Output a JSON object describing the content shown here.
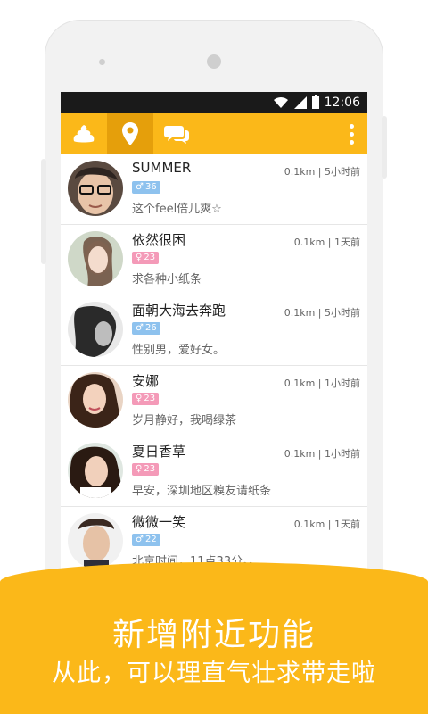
{
  "status_bar": {
    "time": "12:06"
  },
  "toolbar": {
    "tabs": [
      {
        "icon": "poop-icon"
      },
      {
        "icon": "location-pin-icon"
      },
      {
        "icon": "chat-bubbles-icon"
      }
    ],
    "menu_icon": "overflow-menu-icon"
  },
  "colors": {
    "accent": "#fbb819",
    "accent_dark": "#e59f0b",
    "male": "#8ec2ee",
    "female": "#f49ab8"
  },
  "users": [
    {
      "name": "SUMMER",
      "gender": "♂",
      "age": "36",
      "distance_time": "0.1km | 5小时前",
      "signature": "这个feel倍儿爽☆"
    },
    {
      "name": "依然很困",
      "gender": "♀",
      "age": "23",
      "distance_time": "0.1km | 1天前",
      "signature": "求各种小纸条"
    },
    {
      "name": "面朝大海去奔跑",
      "gender": "♂",
      "age": "26",
      "distance_time": "0.1km | 5小时前",
      "signature": "性别男，爱好女。"
    },
    {
      "name": "安娜",
      "gender": "♀",
      "age": "23",
      "distance_time": "0.1km | 1小时前",
      "signature": "岁月静好，我喝绿茶"
    },
    {
      "name": "夏日香草",
      "gender": "♀",
      "age": "23",
      "distance_time": "0.1km | 1小时前",
      "signature": "早安，深圳地区糗友请纸条"
    },
    {
      "name": "微微一笑",
      "gender": "♂",
      "age": "22",
      "distance_time": "0.1km | 1天前",
      "signature": "北京时间，11点33分。。"
    }
  ],
  "banner": {
    "title": "新增附近功能",
    "subtitle": "从此，可以理直气壮求带走啦"
  }
}
